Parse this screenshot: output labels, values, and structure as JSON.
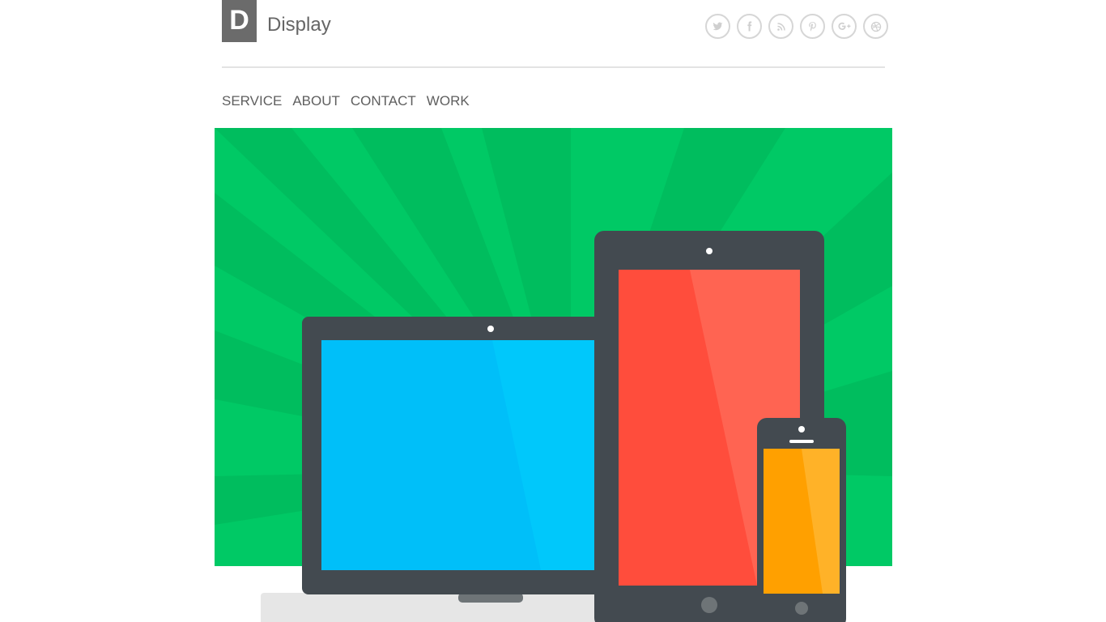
{
  "header": {
    "logo_letter": "D",
    "site_title": "Display",
    "social_icons": [
      "twitter-icon",
      "facebook-icon",
      "rss-icon",
      "pinterest-icon",
      "google-plus-icon",
      "dribbble-icon"
    ]
  },
  "nav": {
    "items": [
      {
        "label": "SERVICE"
      },
      {
        "label": "ABOUT"
      },
      {
        "label": "CONTACT"
      },
      {
        "label": "WORK"
      }
    ]
  },
  "hero": {
    "background_color": "#00c965",
    "ray_color": "#00bd5e",
    "device_frame_color": "#434a50",
    "laptop_screen_color": "#00bff9",
    "tablet_screen_color": "#ff4d3c",
    "phone_screen_color": "#ffa000"
  }
}
